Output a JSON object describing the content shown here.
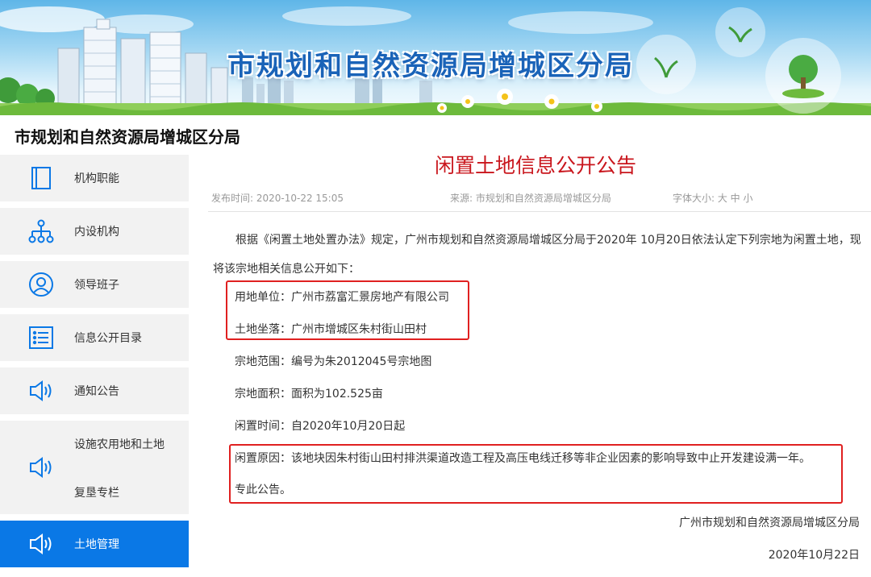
{
  "banner": {
    "title": "市规划和自然资源局增城区分局"
  },
  "site": {
    "title": "市规划和自然资源局增城区分局"
  },
  "sidebar": {
    "items": [
      {
        "label": "机构职能",
        "icon": "document-icon"
      },
      {
        "label": "内设机构",
        "icon": "org-chart-icon"
      },
      {
        "label": "领导班子",
        "icon": "user-icon"
      },
      {
        "label": "信息公开目录",
        "icon": "list-icon"
      },
      {
        "label": "通知公告",
        "icon": "speaker-icon"
      },
      {
        "label": "设施农用地和土地",
        "label2": "复垦专栏",
        "icon": "speaker-icon"
      },
      {
        "label": "土地管理",
        "icon": "speaker-icon",
        "active": true
      }
    ]
  },
  "article": {
    "title": "闲置土地信息公开公告",
    "publish_time": "发布时间: 2020-10-22 15:05",
    "source": "来源: 市规划和自然资源局增城区分局",
    "font_size": "字体大小: 大 中 小",
    "intro": "根据《闲置土地处置办法》规定，广州市规划和自然资源局增城区分局于2020年 10月20日依法认定下列宗地为闲置土地，现将该宗地相关信息公开如下：",
    "land_user": "用地单位：广州市荔富汇景房地产有限公司",
    "location": "土地坐落：广州市增城区朱村街山田村",
    "scope": "宗地范围：编号为朱2012045号宗地图",
    "area": "宗地面积：面积为102.525亩",
    "idle_time": "闲置时间：自2020年10月20日起",
    "reason": "闲置原因：该地块因朱村街山田村排洪渠道改造工程及高压电线迁移等非企业因素的影响导致中止开发建设满一年。",
    "notice": "专此公告。",
    "signature": "广州市规划和自然资源局增城区分局",
    "date": "2020年10月22日"
  },
  "colors": {
    "title_red": "#c9161d",
    "highlight_red": "#e02020",
    "active_blue": "#0a78e6",
    "banner_blue": "#1a63b8"
  }
}
